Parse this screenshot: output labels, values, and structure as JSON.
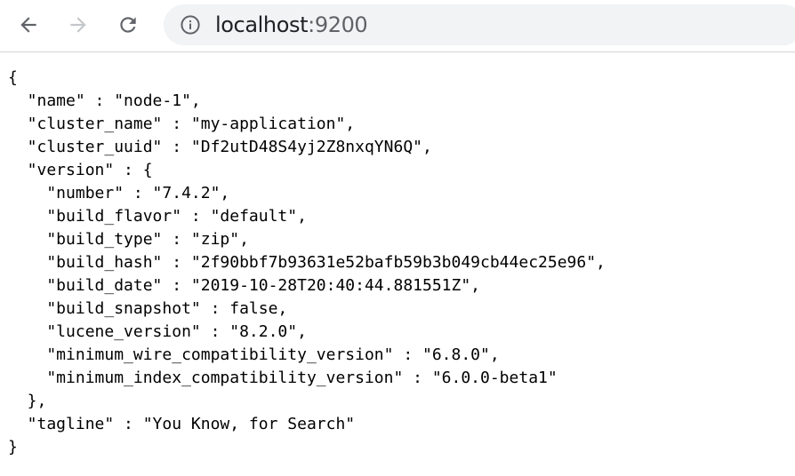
{
  "browser": {
    "address_bar": {
      "host": "localhost",
      "port": ":9200"
    },
    "icons": {
      "back": "arrow-left-icon",
      "forward": "arrow-right-icon",
      "reload": "reload-icon",
      "info": "info-circle-icon"
    }
  },
  "response": {
    "lines": [
      "{",
      "  \"name\" : \"node-1\",",
      "  \"cluster_name\" : \"my-application\",",
      "  \"cluster_uuid\" : \"Df2utD48S4yj2Z8nxqYN6Q\",",
      "  \"version\" : {",
      "    \"number\" : \"7.4.2\",",
      "    \"build_flavor\" : \"default\",",
      "    \"build_type\" : \"zip\",",
      "    \"build_hash\" : \"2f90bbf7b93631e52bafb59b3b049cb44ec25e96\",",
      "    \"build_date\" : \"2019-10-28T20:40:44.881551Z\",",
      "    \"build_snapshot\" : false,",
      "    \"lucene_version\" : \"8.2.0\",",
      "    \"minimum_wire_compatibility_version\" : \"6.8.0\",",
      "    \"minimum_index_compatibility_version\" : \"6.0.0-beta1\"",
      "  },",
      "  \"tagline\" : \"You Know, for Search\"",
      "}"
    ]
  }
}
